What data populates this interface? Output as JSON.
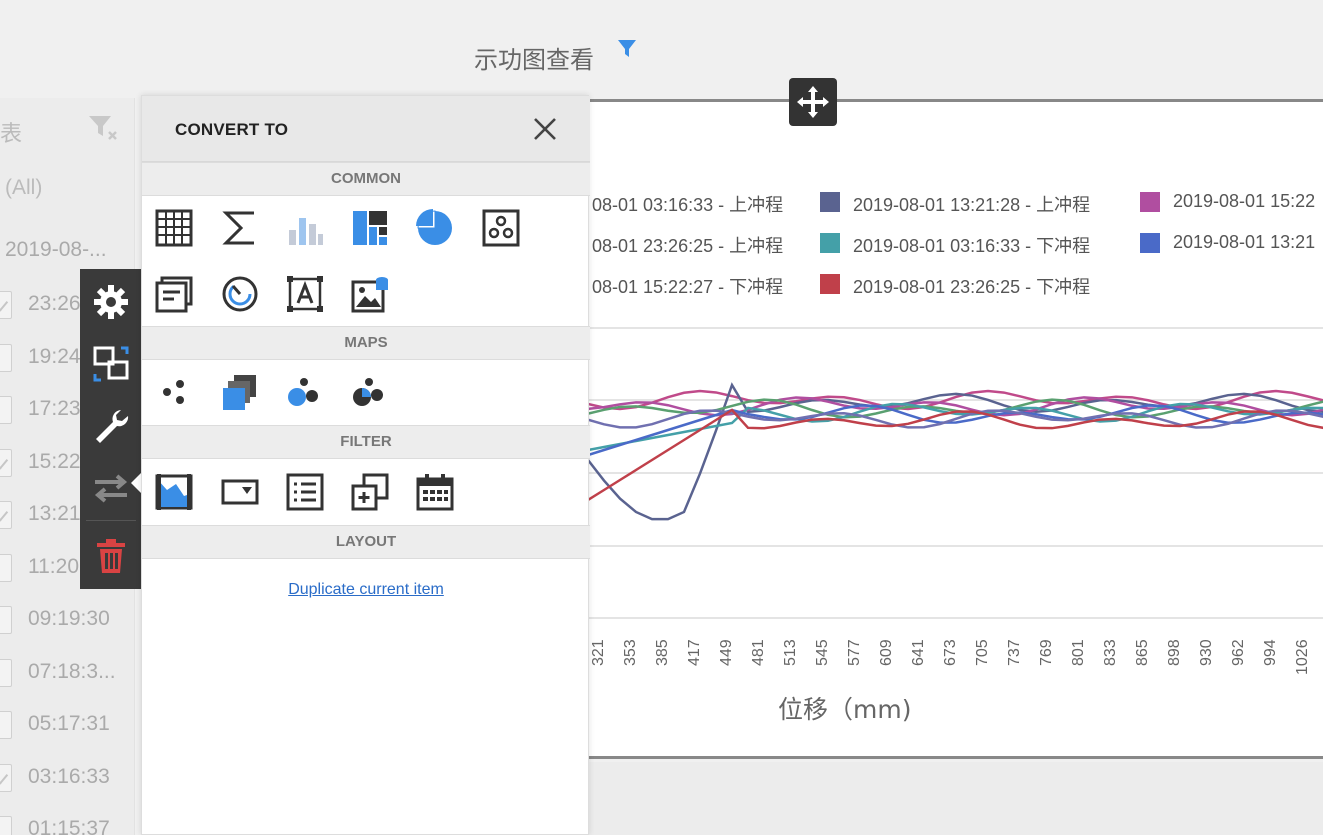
{
  "header": {
    "title": "示功图查看",
    "filter_icon": "filter-icon"
  },
  "list_panel": {
    "title": "表",
    "all_label": "(All)",
    "date_label": "2019-08-...",
    "rows": [
      {
        "time": "23:26",
        "checked": true
      },
      {
        "time": "19:24",
        "checked": false
      },
      {
        "time": "17:23",
        "checked": false
      },
      {
        "time": "15:22",
        "checked": true
      },
      {
        "time": "13:21",
        "checked": true
      },
      {
        "time": "11:20",
        "checked": false
      },
      {
        "time": "09:19:30",
        "checked": false
      },
      {
        "time": "07:18:3...",
        "checked": false
      },
      {
        "time": "05:17:31",
        "checked": false
      },
      {
        "time": "03:16:33",
        "checked": true
      },
      {
        "time": "01:15:37",
        "checked": false
      }
    ]
  },
  "toolbar": {
    "items": [
      "settings-icon",
      "convert-icon",
      "wrench-icon",
      "swap-icon",
      "trash-icon"
    ]
  },
  "convert_panel": {
    "title": "CONVERT TO",
    "sections": {
      "common": "COMMON",
      "maps": "MAPS",
      "filter": "FILTER",
      "layout": "LAYOUT"
    },
    "duplicate_link": "Duplicate current item"
  },
  "chart": {
    "x_label": "位移（mm)",
    "x_ticks": [
      "321",
      "353",
      "385",
      "417",
      "449",
      "481",
      "513",
      "545",
      "577",
      "609",
      "641",
      "673",
      "705",
      "737",
      "769",
      "801",
      "833",
      "865",
      "898",
      "930",
      "962",
      "994",
      "1026"
    ],
    "legend": [
      {
        "label": "08-01 03:16:33 - 上冲程",
        "color": "#c04a8a"
      },
      {
        "label": "2019-08-01 13:21:28 - 上冲程",
        "color": "#5a6390"
      },
      {
        "label": "2019-08-01 15:22",
        "color": "#b04ea0"
      },
      {
        "label": "08-01 23:26:25 - 上冲程",
        "color": "#5aa070"
      },
      {
        "label": "2019-08-01 03:16:33 - 下冲程",
        "color": "#44a0a8"
      },
      {
        "label": "2019-08-01 13:21",
        "color": "#4a6ac8"
      },
      {
        "label": "08-01 15:22:27 - 下冲程",
        "color": "#7070b0"
      },
      {
        "label": "2019-08-01 23:26:25 - 下冲程",
        "color": "#c0404a"
      }
    ]
  }
}
